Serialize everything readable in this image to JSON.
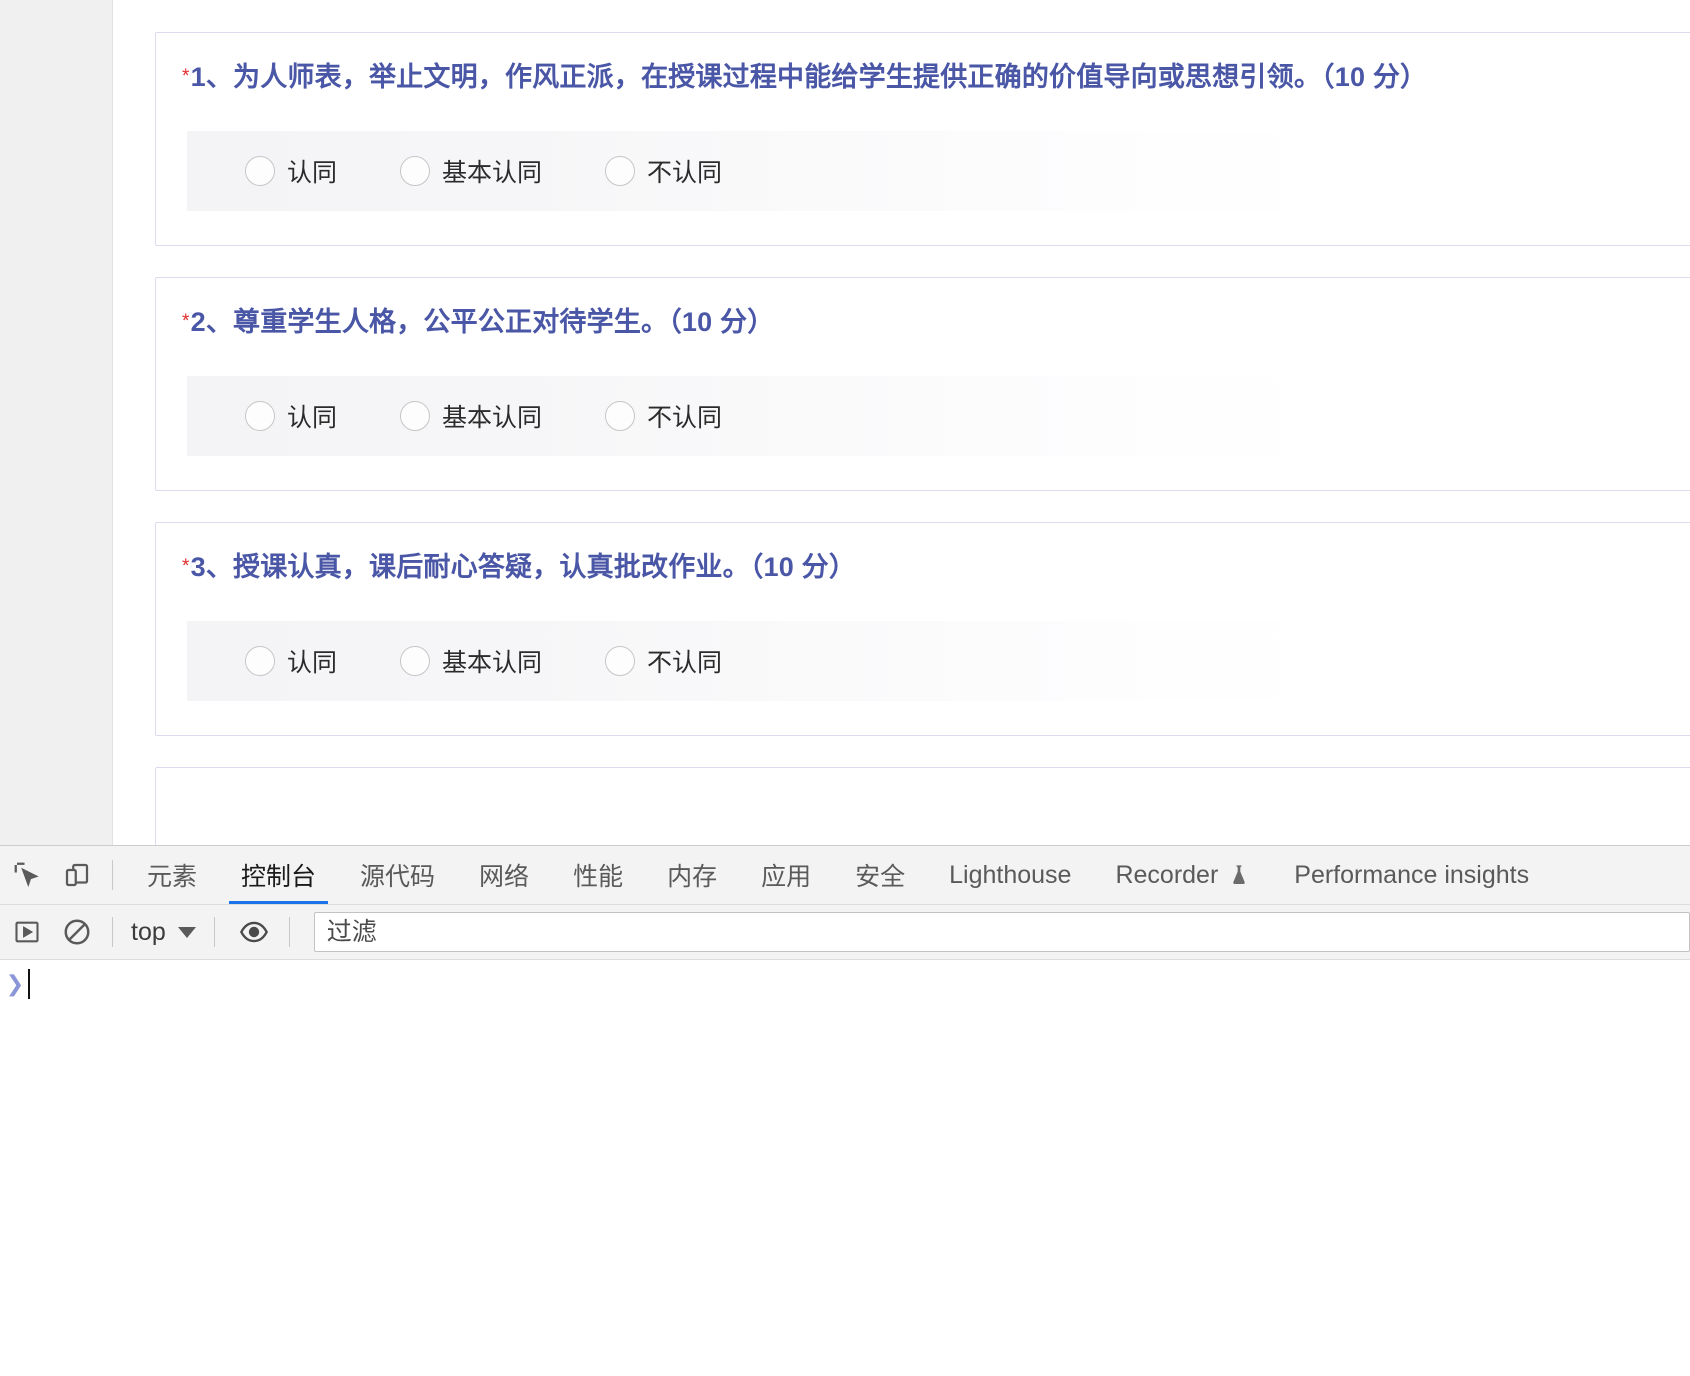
{
  "survey": {
    "required_marker": "*",
    "questions": [
      {
        "title": "1、为人师表，举止文明，作风正派，在授课过程中能给学生提供正确的价值导向或思想引领。（10 分）",
        "options": [
          "认同",
          "基本认同",
          "不认同"
        ]
      },
      {
        "title": "2、尊重学生人格，公平公正对待学生。（10 分）",
        "options": [
          "认同",
          "基本认同",
          "不认同"
        ]
      },
      {
        "title": "3、授课认真，课后耐心答疑，认真批改作业。（10 分）",
        "options": [
          "认同",
          "基本认同",
          "不认同"
        ]
      }
    ]
  },
  "devtools": {
    "tabs": [
      {
        "label": "元素",
        "active": false
      },
      {
        "label": "控制台",
        "active": true
      },
      {
        "label": "源代码",
        "active": false
      },
      {
        "label": "网络",
        "active": false
      },
      {
        "label": "性能",
        "active": false
      },
      {
        "label": "内存",
        "active": false
      },
      {
        "label": "应用",
        "active": false
      },
      {
        "label": "安全",
        "active": false
      },
      {
        "label": "Lighthouse",
        "active": false
      },
      {
        "label": "Recorder",
        "active": false
      },
      {
        "label": "Performance insights",
        "active": false
      }
    ],
    "icons": {
      "inspect": "inspect-element-icon",
      "device": "device-toolbar-icon",
      "execution_context": "execution-context-icon",
      "clear": "clear-console-icon",
      "eye": "live-expression-eye-icon",
      "flask": "experimental-flask-icon"
    },
    "toolbar": {
      "context_label": "top",
      "filter_placeholder": "过滤",
      "filter_value": ""
    },
    "console": {
      "prompt_symbol": "❯",
      "input_value": ""
    }
  },
  "colors": {
    "question_text": "#4a56a6",
    "required_star": "#e02b2b",
    "card_border": "#dcdcee",
    "tab_active_underline": "#1a73e8",
    "sidebar_bg": "#f0f0f0"
  }
}
